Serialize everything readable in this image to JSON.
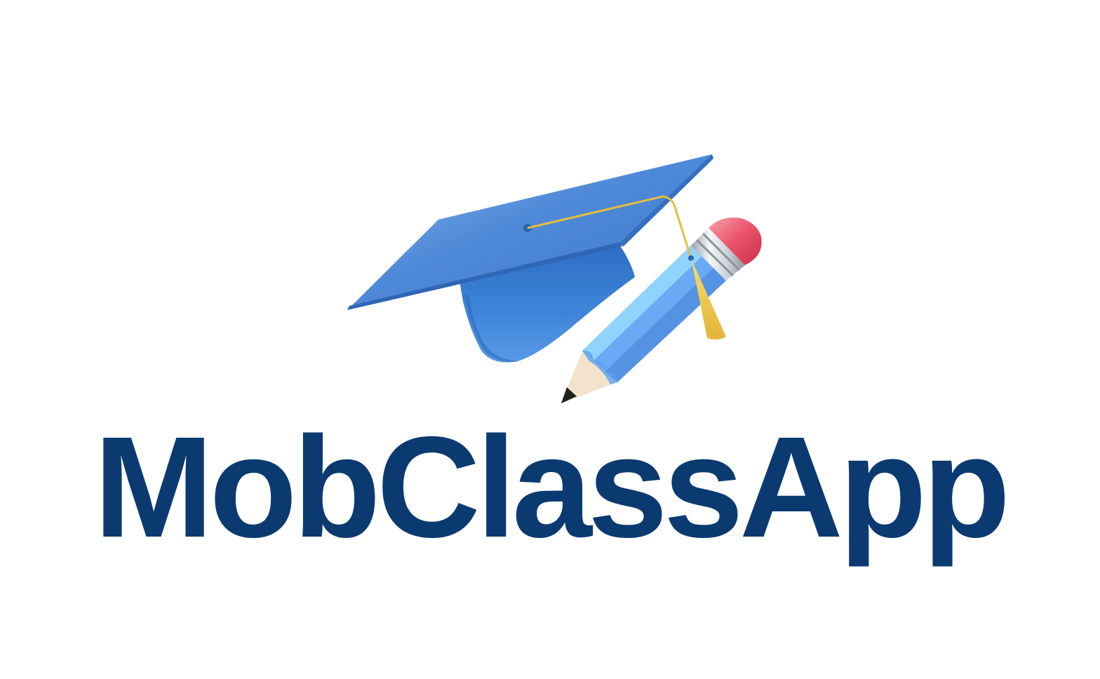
{
  "brand": {
    "name": "MobClassApp",
    "wordmark_color": "#0b3a70",
    "background_color": "#ffffff"
  },
  "logo": {
    "icon_name": "graduation-cap-with-pencil-icon",
    "cap_color": "#4a86d6",
    "tassel_color": "#f2c94c",
    "pencil_body_color": "#6aaaf5",
    "eraser_color": "#e8485f"
  }
}
